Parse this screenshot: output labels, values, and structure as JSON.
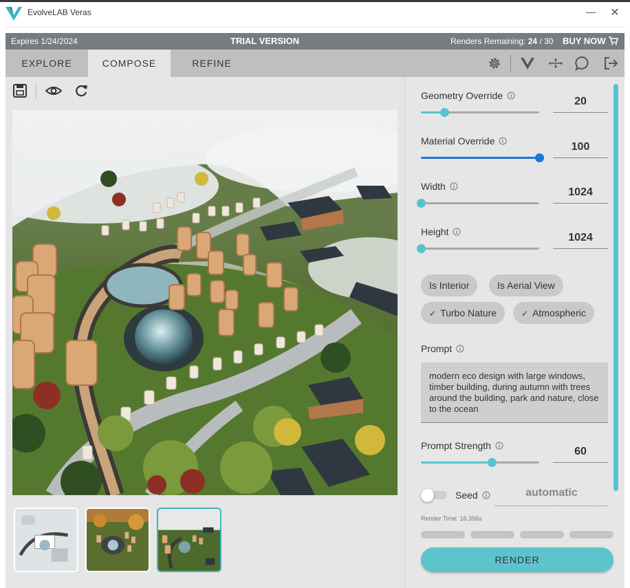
{
  "window": {
    "title": "EvolveLAB Veras",
    "minimize_glyph": "—",
    "close_glyph": "✕"
  },
  "status": {
    "expires": "Expires 1/24/2024",
    "trial": "TRIAL VERSION",
    "renders_label": "Renders Remaining:",
    "renders_value": "24",
    "renders_total": "/ 30",
    "buy_now": "BUY NOW"
  },
  "tabs": [
    {
      "label": "EXPLORE"
    },
    {
      "label": "COMPOSE",
      "active": true
    },
    {
      "label": "REFINE"
    }
  ],
  "nav_icons": [
    "settings-icon",
    "veras-logo-icon",
    "network-icon",
    "chat-icon",
    "logout-icon"
  ],
  "toolbar_icons": [
    "save-icon",
    "eye-icon",
    "refresh-icon"
  ],
  "controls": {
    "geometry": {
      "label": "Geometry Override",
      "value": "20",
      "fraction": 0.2
    },
    "material": {
      "label": "Material Override",
      "value": "100",
      "fraction": 1.0
    },
    "width": {
      "label": "Width",
      "value": "1024",
      "fraction": 0.0
    },
    "height": {
      "label": "Height",
      "value": "1024",
      "fraction": 0.0
    }
  },
  "chips": [
    {
      "label": "Is Interior",
      "checked": false
    },
    {
      "label": "Is Aerial View",
      "checked": false
    },
    {
      "label": "Turbo Nature",
      "checked": true
    },
    {
      "label": "Atmospheric",
      "checked": true
    }
  ],
  "prompt": {
    "label": "Prompt",
    "text": "modern eco design with large windows, timber building, during autumn with trees around the building, park and nature, close to the ocean"
  },
  "prompt_strength": {
    "label": "Prompt Strength",
    "value": "60",
    "fraction": 0.6
  },
  "seed": {
    "label": "Seed",
    "value": "automatic",
    "enabled": false
  },
  "render_time": "Render Time: 16.356s",
  "render_button": "RENDER",
  "thumbnails": [
    {
      "name": "render-thumbnail-1",
      "selected": false
    },
    {
      "name": "render-thumbnail-2",
      "selected": false
    },
    {
      "name": "render-thumbnail-3",
      "selected": true
    }
  ],
  "colors": {
    "accent": "#55c4d0",
    "slider_blue": "#1a7ad9",
    "status_bar": "#767c7f",
    "nav_bar": "#bfbfbf",
    "panel": "#e6e6e6"
  }
}
